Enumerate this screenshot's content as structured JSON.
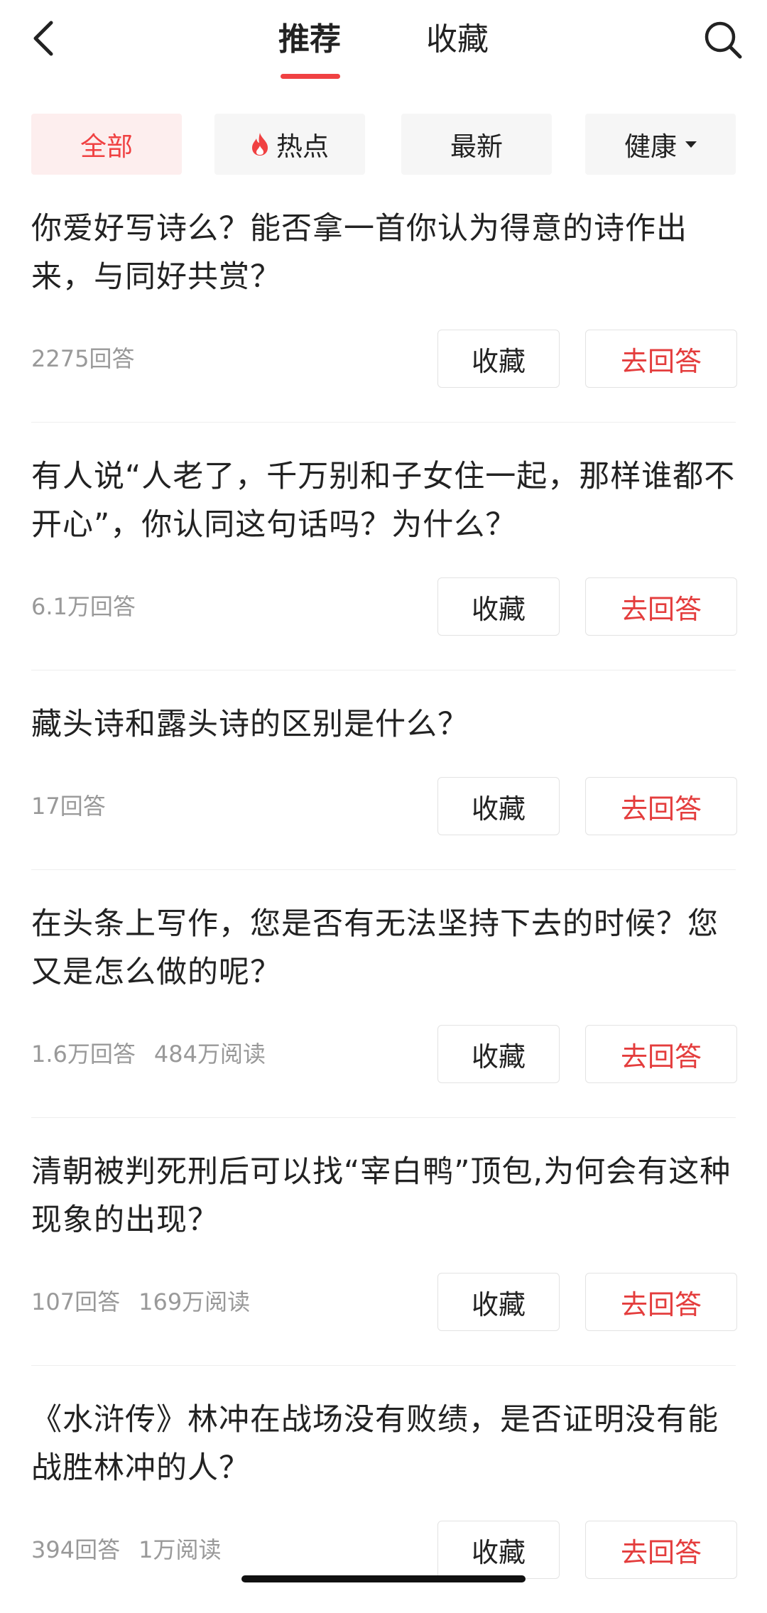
{
  "header": {
    "tabs": [
      {
        "label": "推荐",
        "active": true
      },
      {
        "label": "收藏",
        "active": false
      }
    ],
    "back_icon": "chevron-left-icon",
    "search_icon": "search-icon"
  },
  "filters": [
    {
      "label": "全部",
      "active": true
    },
    {
      "label": "热点",
      "icon": "fire-icon"
    },
    {
      "label": "最新"
    },
    {
      "label": "健康",
      "icon": "caret-down-icon"
    }
  ],
  "colors": {
    "accent": "#f04142",
    "answer_text": "#e43d3d",
    "meta_text": "#999999",
    "chip_bg": "#f6f6f6",
    "chip_active_bg": "#fdeeee"
  },
  "questions": [
    {
      "title": "你爱好写诗么？能否拿一首你认为得意的诗作出来，与同好共赏？",
      "answers": "2275回答",
      "reads": "",
      "fav_label": "收藏",
      "answer_label": "去回答"
    },
    {
      "title": "有人说“人老了，千万别和子女住一起，那样谁都不开心”，你认同这句话吗？为什么？",
      "answers": "6.1万回答",
      "reads": "",
      "fav_label": "收藏",
      "answer_label": "去回答"
    },
    {
      "title": "藏头诗和露头诗的区别是什么？",
      "answers": "17回答",
      "reads": "",
      "fav_label": "收藏",
      "answer_label": "去回答"
    },
    {
      "title": "在头条上写作，您是否有无法坚持下去的时候？您又是怎么做的呢？",
      "answers": "1.6万回答",
      "reads": "484万阅读",
      "fav_label": "收藏",
      "answer_label": "去回答"
    },
    {
      "title": "清朝被判死刑后可以找“宰白鸭”顶包,为何会有这种现象的出现？",
      "answers": "107回答",
      "reads": "169万阅读",
      "fav_label": "收藏",
      "answer_label": "去回答"
    },
    {
      "title": "《水浒传》林冲在战场没有败绩，是否证明没有能战胜林冲的人？",
      "answers": "394回答",
      "reads": "1万阅读",
      "fav_label": "收藏",
      "answer_label": "去回答"
    }
  ]
}
